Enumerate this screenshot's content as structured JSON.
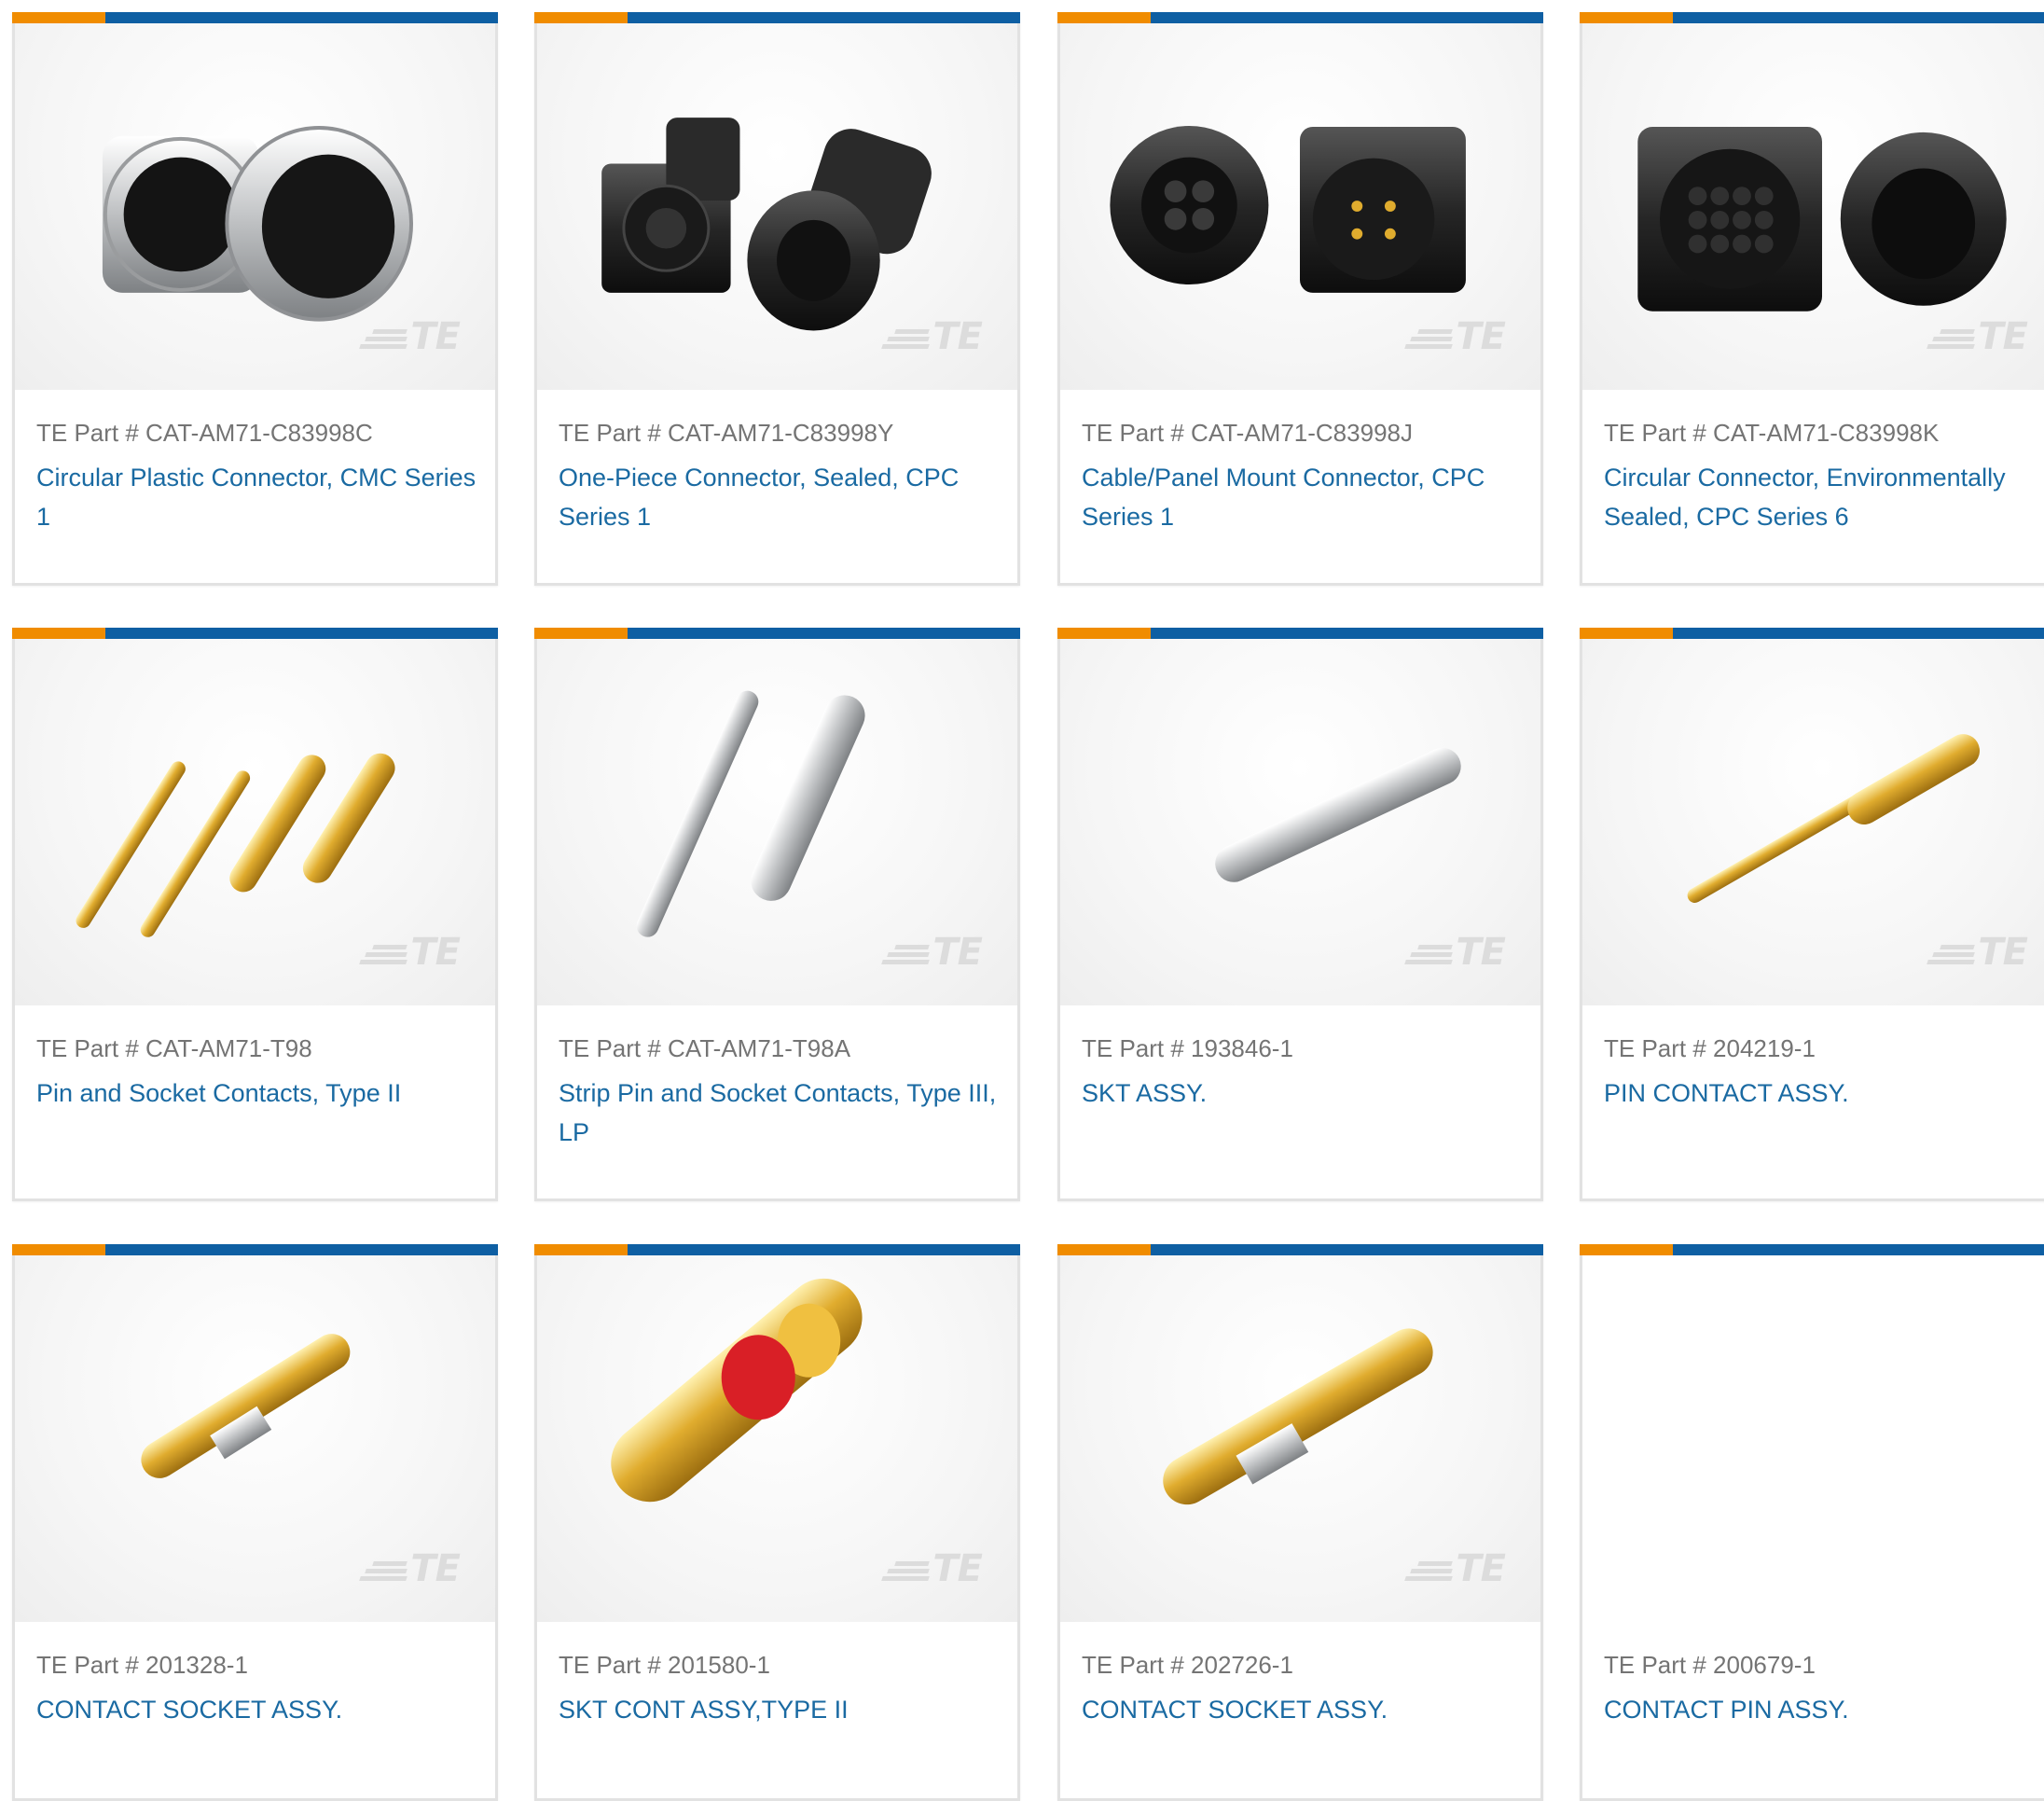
{
  "colors": {
    "accent_orange": "#f08c00",
    "accent_blue": "#0e5fa3",
    "title_link": "#1a6aa2",
    "part_text": "#747474",
    "card_border": "#e2e2e2"
  },
  "logo_text": "TE",
  "products": [
    {
      "part_label": "TE Part # CAT-AM71-C83998C",
      "title": "Circular Plastic Connector, CMC Series 1",
      "image": "metal-circular-connector-pair"
    },
    {
      "part_label": "TE Part # CAT-AM71-C83998Y",
      "title": "One-Piece Connector, Sealed, CPC Series 1",
      "image": "black-square-flange-connector-pair"
    },
    {
      "part_label": "TE Part # CAT-AM71-C83998J",
      "title": "Cable/Panel Mount Connector, CPC Series 1",
      "image": "black-4pin-connector-pair"
    },
    {
      "part_label": "TE Part # CAT-AM71-C83998K",
      "title": "Circular Connector, Environmentally Sealed, CPC Series 6",
      "image": "black-multipin-connector-pair"
    },
    {
      "part_label": "TE Part # CAT-AM71-T98",
      "title": "Pin and Socket Contacts, Type II",
      "image": "gold-pin-socket-contacts"
    },
    {
      "part_label": "TE Part # CAT-AM71-T98A",
      "title": "Strip Pin and Socket Contacts, Type III, LP",
      "image": "silver-strip-contacts"
    },
    {
      "part_label": "TE Part # 193846-1",
      "title": "SKT ASSY.",
      "image": "silver-socket"
    },
    {
      "part_label": "TE Part # 204219-1",
      "title": "PIN CONTACT ASSY.",
      "image": "gold-pin-contact"
    },
    {
      "part_label": "TE Part # 201328-1",
      "title": "CONTACT SOCKET ASSY.",
      "image": "gold-socket-contact"
    },
    {
      "part_label": "TE Part # 201580-1",
      "title": "SKT CONT ASSY,TYPE II",
      "image": "socket-with-red-collar"
    },
    {
      "part_label": "TE Part # 202726-1",
      "title": "CONTACT SOCKET ASSY.",
      "image": "gold-socket-contact-2"
    },
    {
      "part_label": "TE Part # 200679-1",
      "title": "CONTACT PIN ASSY.",
      "image": "no-image"
    }
  ]
}
